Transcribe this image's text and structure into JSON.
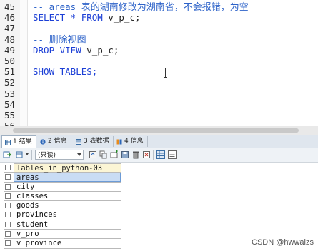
{
  "editor": {
    "lines": [
      {
        "num": "45",
        "parts": [
          {
            "t": "-- areas ",
            "c": "cm"
          },
          {
            "t": "表的湖南修改为湖南省，不会报错，为空",
            "c": "cm cm-cjk"
          }
        ]
      },
      {
        "num": "46",
        "parts": [
          {
            "t": "SELECT * FROM ",
            "c": "kw"
          },
          {
            "t": "v_p_c;",
            "c": "plain"
          }
        ]
      },
      {
        "num": "47",
        "parts": []
      },
      {
        "num": "48",
        "parts": [
          {
            "t": "-- ",
            "c": "cm"
          },
          {
            "t": "删除视图",
            "c": "cm cm-cjk"
          }
        ]
      },
      {
        "num": "49",
        "parts": [
          {
            "t": "DROP VIEW ",
            "c": "kw"
          },
          {
            "t": "v_p_c;",
            "c": "plain"
          }
        ]
      },
      {
        "num": "50",
        "parts": []
      },
      {
        "num": "51",
        "parts": [
          {
            "t": "SHOW TABLES;",
            "c": "kw"
          }
        ]
      },
      {
        "num": "52",
        "parts": []
      },
      {
        "num": "53",
        "parts": []
      },
      {
        "num": "54",
        "parts": []
      },
      {
        "num": "55",
        "parts": []
      },
      {
        "num": "56",
        "parts": []
      }
    ]
  },
  "tabs": [
    {
      "label": "1 结果",
      "icon": "grid-icon"
    },
    {
      "label": "2 信息",
      "icon": "info-icon"
    },
    {
      "label": "3 表数据",
      "icon": "table-icon"
    },
    {
      "label": "4 信息",
      "icon": "info-icon"
    }
  ],
  "toolbar": {
    "mode_select": "(只读)"
  },
  "result": {
    "header": "Tables_in_python-03",
    "rows": [
      "areas",
      "city",
      "classes",
      "goods",
      "provinces",
      "student",
      "v_pro",
      "v_province"
    ]
  },
  "watermark": "CSDN @hwwaizs",
  "colors": {
    "keyword": "#1c3fd6",
    "comment": "#2e63c9",
    "header_bg": "#fbf5d5",
    "selected_bg": "#c9dcf4"
  }
}
